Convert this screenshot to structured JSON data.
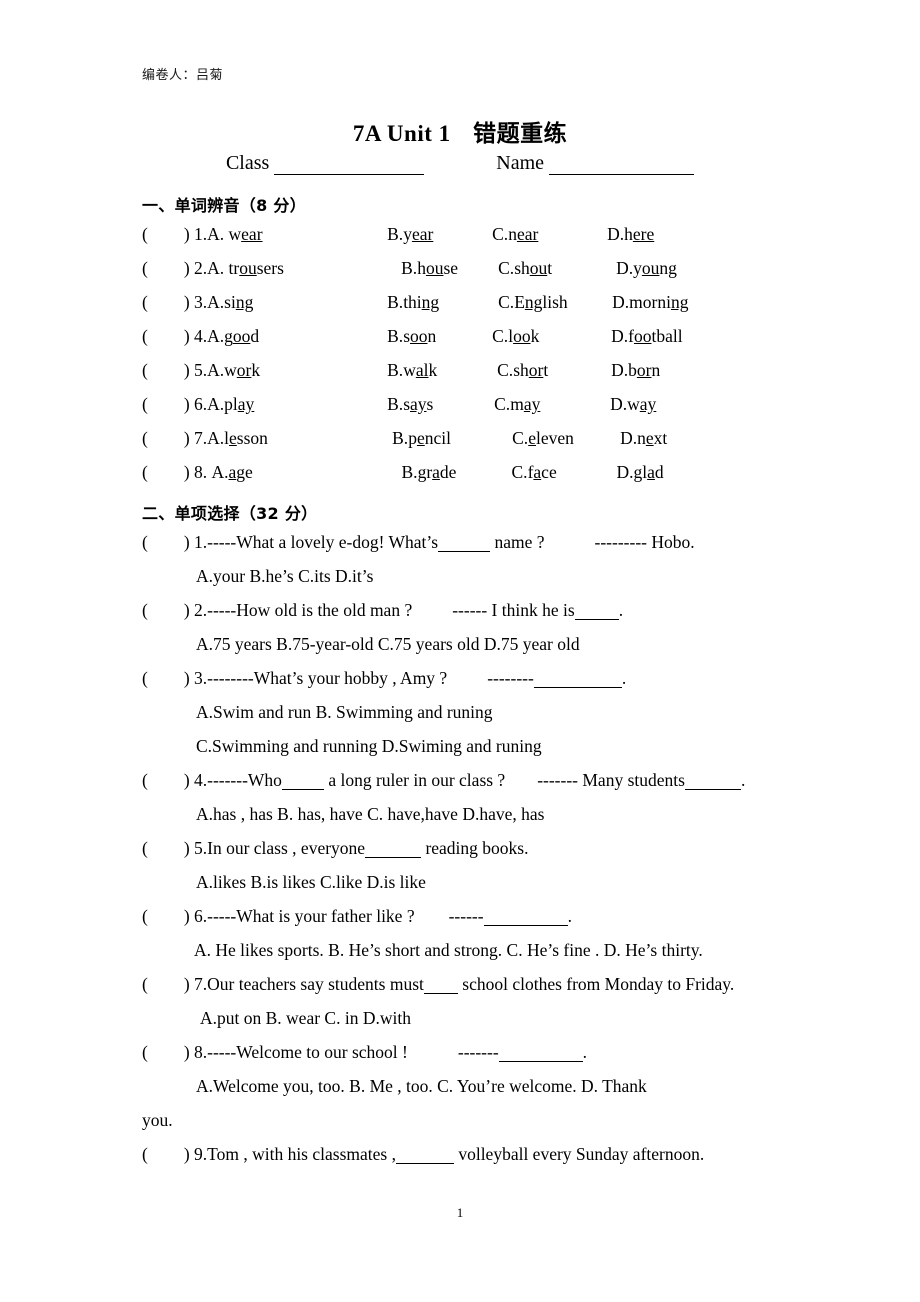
{
  "meta": {
    "author_label": "编卷人：吕菊",
    "page_number": "1"
  },
  "header": {
    "title_en": "7A Unit 1",
    "title_cn": "错题重练",
    "class_label": "Class",
    "name_label": "Name"
  },
  "sections": [
    {
      "heading": "一、单词辨音（8 分）",
      "questions": [
        {
          "num": "1.",
          "options": [
            {
              "label": "A. ",
              "pre": "w",
              "mid": "ear",
              "post": ""
            },
            {
              "label": "B.",
              "pre": "y",
              "mid": "ear",
              "post": ""
            },
            {
              "label": "C.",
              "pre": "n",
              "mid": "ear",
              "post": ""
            },
            {
              "label": "D.",
              "pre": "h",
              "mid": "ere",
              "post": ""
            }
          ]
        },
        {
          "num": "2.",
          "options": [
            {
              "label": "A. ",
              "pre": "tr",
              "mid": "ou",
              "post": "sers"
            },
            {
              "label": "B.",
              "pre": "h",
              "mid": "ou",
              "post": "se"
            },
            {
              "label": "C.",
              "pre": "sh",
              "mid": "ou",
              "post": "t"
            },
            {
              "label": "D.",
              "pre": "y",
              "mid": "ou",
              "post": "ng"
            }
          ]
        },
        {
          "num": "3.",
          "options": [
            {
              "label": "A.",
              "pre": "si",
              "mid": "ng",
              "post": ""
            },
            {
              "label": "B.",
              "pre": "thi",
              "mid": "ng",
              "post": ""
            },
            {
              "label": "C.",
              "pre": "E",
              "mid": "ng",
              "post": "lish"
            },
            {
              "label": "D.",
              "pre": "morni",
              "mid": "ng",
              "post": ""
            }
          ]
        },
        {
          "num": "4.",
          "options": [
            {
              "label": "A.",
              "pre": "g",
              "mid": "oo",
              "post": "d"
            },
            {
              "label": "B.",
              "pre": "s",
              "mid": "oo",
              "post": "n"
            },
            {
              "label": "C.",
              "pre": "l",
              "mid": "oo",
              "post": "k"
            },
            {
              "label": "D.",
              "pre": "f",
              "mid": "oo",
              "post": "tball"
            }
          ]
        },
        {
          "num": "5.",
          "options": [
            {
              "label": "A.",
              "pre": "w",
              "mid": "or",
              "post": "k"
            },
            {
              "label": "B.",
              "pre": "w",
              "mid": "al",
              "post": "k"
            },
            {
              "label": "C.",
              "pre": "sh",
              "mid": "or",
              "post": "t"
            },
            {
              "label": "D.",
              "pre": "b",
              "mid": "or",
              "post": "n"
            }
          ]
        },
        {
          "num": "6.",
          "options": [
            {
              "label": "A.",
              "pre": "pl",
              "mid": "ay",
              "post": ""
            },
            {
              "label": "B.",
              "pre": "s",
              "mid": "ay",
              "post": "s"
            },
            {
              "label": "C.",
              "pre": "m",
              "mid": "ay",
              "post": ""
            },
            {
              "label": "D.",
              "pre": "w",
              "mid": "ay",
              "post": ""
            }
          ]
        },
        {
          "num": "7.",
          "options": [
            {
              "label": "A.",
              "pre": "l",
              "mid": "e",
              "post": "sson"
            },
            {
              "label": "B.",
              "pre": "p",
              "mid": "e",
              "post": "ncil"
            },
            {
              "label": "C.",
              "pre": "",
              "mid": "e",
              "post": "leven"
            },
            {
              "label": "D.",
              "pre": "n",
              "mid": "e",
              "post": "xt"
            }
          ]
        },
        {
          "num": "8. ",
          "options": [
            {
              "label": "A.",
              "pre": "",
              "mid": "a",
              "post": "ge"
            },
            {
              "label": "B.",
              "pre": "gr",
              "mid": "a",
              "post": "de"
            },
            {
              "label": "C.",
              "pre": "f",
              "mid": "a",
              "post": "ce"
            },
            {
              "label": "D.",
              "pre": "gl",
              "mid": "a",
              "post": "d"
            }
          ]
        }
      ]
    },
    {
      "heading": "二、单项选择（32 分）",
      "questions": [
        {
          "num": "1.",
          "stem_a": "-----What a lovely e-dog! What’s",
          "stem_b": "name ?",
          "stem_c": "--------- Hobo.",
          "options_line": "A.your          B.he’s       C.its        D.it’s"
        },
        {
          "num": "2.",
          "stem_a": "-----How old is the old man ?",
          "stem_b": "------ I think he is",
          "stem_c": ".",
          "options_line": "A.75 years    B.75-year-old     C.75 years old     D.75 year old"
        },
        {
          "num": "3.",
          "stem_a": "--------What’s your hobby , Amy ?",
          "stem_b": "--------",
          "stem_c": ".",
          "options_line_1": "A.Swim and run                       B. Swimming and runing",
          "options_line_2": "C.Swimming and running          D.Swiming and runing"
        },
        {
          "num": "4.",
          "stem_a": "-------Who",
          "stem_b": "a long ruler in our class ?",
          "stem_c": "------- Many students",
          "stem_d": ".",
          "options_line": "A.has , has   B. has, have    C. have,have    D.have, has"
        },
        {
          "num": "5.",
          "stem_a": "In our class , everyone",
          "stem_b": "reading books.",
          "options_line": "A.likes        B.is likes        C.like        D.is like"
        },
        {
          "num": "6.",
          "stem_a": "-----What is your father like ?",
          "stem_b": "------",
          "stem_c": ".",
          "options_line": "A. He likes sports.    B. He’s short and strong.    C. He’s fine .    D. He’s thirty."
        },
        {
          "num": "7.",
          "stem_a": "Our teachers say students must",
          "stem_b": "school clothes from Monday to Friday.",
          "options_line": "A.put on   B. wear    C. in        D.with"
        },
        {
          "num": "8.",
          "stem_a": "-----Welcome to our school !",
          "stem_b": "-------",
          "stem_c": ".",
          "options_line": "A.Welcome you, too.    B. Me , too.     C. You’re welcome.      D. Thank",
          "options_line_overflow": "you."
        },
        {
          "num": "9.",
          "stem_a": "Tom , with his classmates ,",
          "stem_b": "volleyball every Sunday afternoon."
        }
      ]
    }
  ]
}
